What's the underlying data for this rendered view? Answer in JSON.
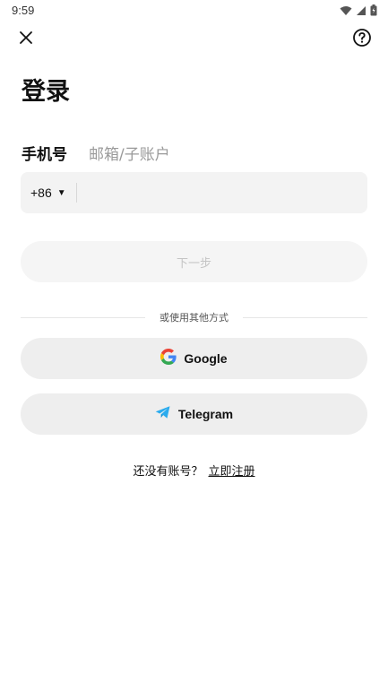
{
  "status_bar": {
    "time": "9:59"
  },
  "header": {
    "close_icon": "close-icon",
    "help_icon": "help-circle-icon"
  },
  "title": "登录",
  "tabs": [
    {
      "label": "手机号",
      "active": true
    },
    {
      "label": "邮箱/子账户",
      "active": false
    }
  ],
  "phone": {
    "country_code": "+86",
    "value": "",
    "placeholder": ""
  },
  "next_button": {
    "label": "下一步"
  },
  "divider_text": "或使用其他方式",
  "social": [
    {
      "label": "Google",
      "icon": "google-icon"
    },
    {
      "label": "Telegram",
      "icon": "telegram-icon"
    }
  ],
  "register": {
    "prompt": "还没有账号？",
    "link": "立即注册"
  },
  "colors": {
    "field_bg": "#f3f3f3",
    "button_bg": "#eeeeee",
    "disabled_text": "#c4c4c4",
    "telegram_blue": "#2AABEE"
  }
}
